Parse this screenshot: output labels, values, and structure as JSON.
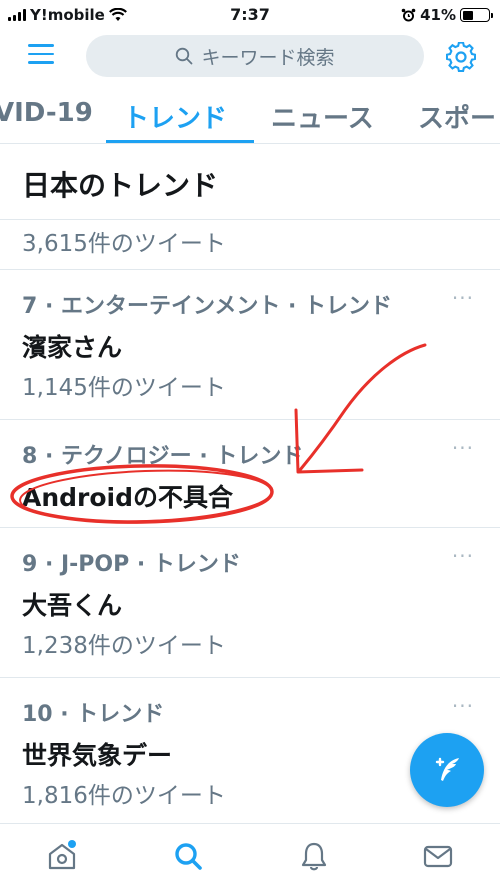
{
  "status_bar": {
    "carrier": "Y!mobile",
    "time": "7:37",
    "battery": "41%",
    "battery_level": 0.41
  },
  "header": {
    "search_placeholder": "キーワード検索",
    "icons": [
      "menu-icon",
      "search-icon",
      "gear-icon"
    ]
  },
  "tabs": [
    {
      "label": "VID-19",
      "active": false
    },
    {
      "label": "トレンド",
      "active": true
    },
    {
      "label": "ニュース",
      "active": false
    },
    {
      "label": "スポー",
      "active": false
    }
  ],
  "section": {
    "title": "日本のトレンド"
  },
  "partial_item": {
    "count": "3,615件のツイート"
  },
  "trends": [
    {
      "category": "7 · エンターテインメント · トレンド",
      "name": "濱家さん",
      "count": "1,145件のツイート"
    },
    {
      "category": "8 · テクノロジー · トレンド",
      "name": "Androidの不具合",
      "count": ""
    },
    {
      "category": "9 · J-POP · トレンド",
      "name": "大吾くん",
      "count": "1,238件のツイート"
    },
    {
      "category": "10 · トレンド",
      "name": "世界気象デー",
      "count": "1,816件のツイート"
    }
  ],
  "more_label": "···",
  "colors": {
    "accent": "#1da1f2",
    "secondary_text": "#657786",
    "primary_text": "#14171a",
    "annotation": "#e8302a"
  },
  "bottom_nav": [
    "home-icon",
    "search-icon",
    "notifications-icon",
    "messages-icon"
  ],
  "fab_icon": "compose-tweet-icon"
}
